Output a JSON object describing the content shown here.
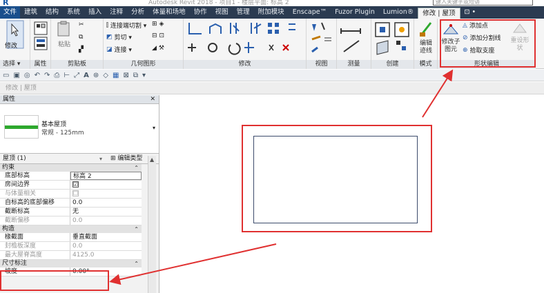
{
  "titlebar": {
    "title": "Autodesk Revit 2018 - 项目1 - 楼层平面: 标高 2",
    "search_placeholder": "键入关键字或短语"
  },
  "tabs": [
    "文件",
    "建筑",
    "结构",
    "系统",
    "插入",
    "注释",
    "分析",
    "体量和场地",
    "协作",
    "视图",
    "管理",
    "附加模块",
    "Enscape™",
    "Fuzor Plugin",
    "Lumion®",
    "修改 | 屋顶",
    "⊡ •"
  ],
  "ribbon": {
    "modify_label": "修改",
    "select_label": "选择 ▾",
    "properties_label": "属性",
    "paste_label": "粘贴",
    "clipboard_label": "剪贴板",
    "cope_label": "连接端切割 ▾",
    "cut_label": "剪切 ▾",
    "join_label": "连接 ▾",
    "geometry_label": "几何图形",
    "modify_panel_label": "修改",
    "view_label": "视图",
    "measure_label": "测量",
    "create_label": "创建",
    "edit_boundary_label": "编辑迹线",
    "mode_label": "模式",
    "modify_sub_label": "修改子图元",
    "add_point_label": "添加点",
    "add_split_line_label": "添加分割线",
    "pick_supports_label": "拾取支座",
    "reset_shape_label": "重设形状",
    "shape_editing_label": "形状编辑"
  },
  "breadcrumb": "修改 | 屋顶",
  "properties": {
    "header": "属性",
    "type_name": "基本屋顶",
    "type_sub": "常规 - 125mm",
    "instance_label": "屋顶 (1)",
    "edit_type_label": "编辑类型",
    "groups": [
      {
        "name": "约束",
        "rows": [
          {
            "k": "底部标高",
            "v": "标高 2"
          },
          {
            "k": "房间边界",
            "v": "☑"
          },
          {
            "k": "与体量相关",
            "v": "☐"
          },
          {
            "k": "自标高的底部偏移",
            "v": "0.0"
          },
          {
            "k": "截断标高",
            "v": "无"
          },
          {
            "k": "截断偏移",
            "v": "0.0"
          }
        ]
      },
      {
        "name": "构造",
        "rows": [
          {
            "k": "椽截面",
            "v": "垂直截面"
          },
          {
            "k": "封檐板深度",
            "v": "0.0"
          },
          {
            "k": "最大屋脊高度",
            "v": "4125.0"
          }
        ]
      },
      {
        "name": "尺寸标注",
        "rows": [
          {
            "k": "坡度",
            "v": "0.00°"
          }
        ]
      }
    ]
  },
  "colors": {
    "ribbon_tab_bg": "#2b3b51",
    "file_tab_bg": "#1a4f8c",
    "annotation_red": "#e03030",
    "outline": "#3b4a6b"
  }
}
